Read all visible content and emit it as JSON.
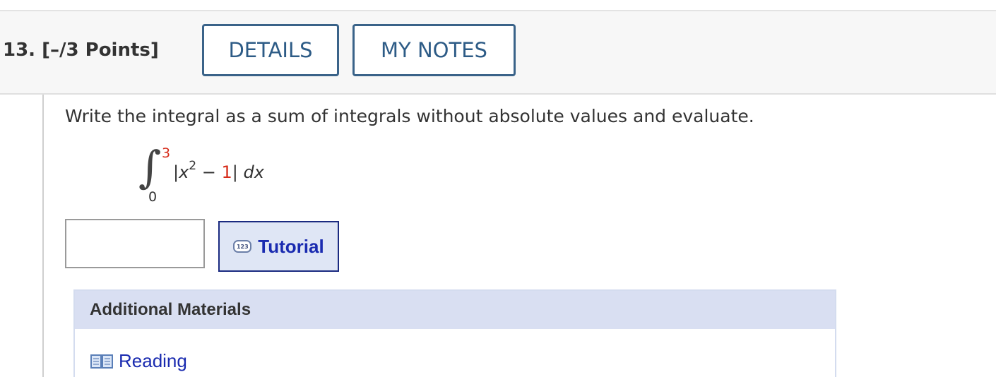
{
  "question": {
    "number_label": "13.  [–/3 Points]",
    "details_label": "DETAILS",
    "notes_label": "MY NOTES",
    "prompt": "Write the integral as a sum of integrals without absolute values and evaluate.",
    "integral": {
      "sign": "∫",
      "upper_limit": "3",
      "lower_limit": "0",
      "integrand_open": "|",
      "variable": "x",
      "exponent": "2",
      "minus": " − ",
      "constant": "1",
      "integrand_close": "|",
      "differential": " dx"
    },
    "answer": {
      "value": "",
      "placeholder": ""
    },
    "tutorial": {
      "icon_text": "123",
      "label": "Tutorial"
    }
  },
  "additional_materials": {
    "heading": "Additional Materials",
    "items": [
      {
        "label": "Reading",
        "icon": "book-icon"
      }
    ]
  },
  "colors": {
    "header_button_border": "#3a6389",
    "limit_red": "#d62c1a",
    "link_blue": "#1a2bb0",
    "materials_header_bg": "#d9dff2"
  }
}
